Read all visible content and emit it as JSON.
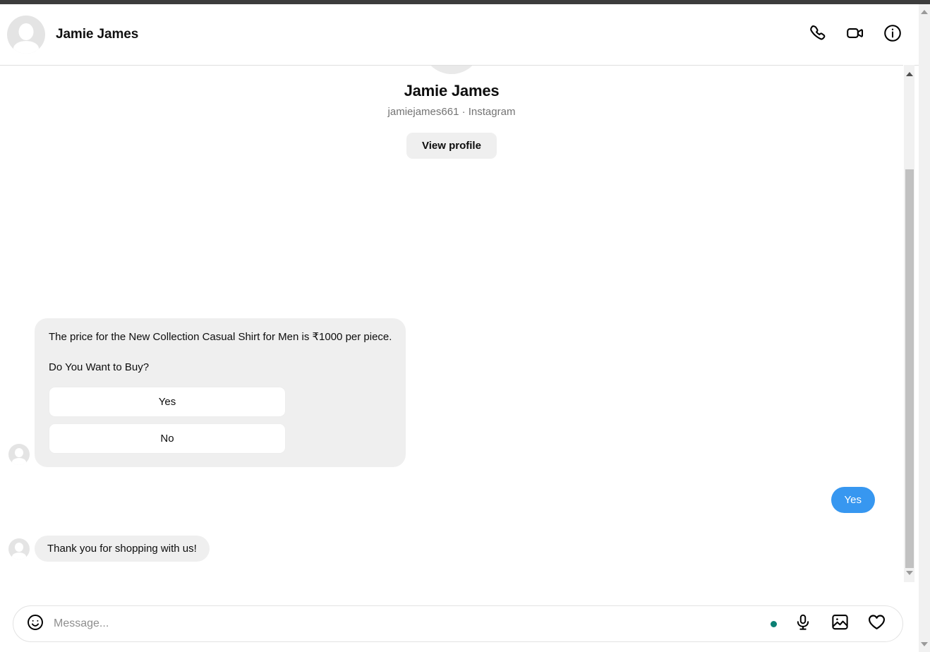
{
  "header": {
    "contact_name": "Jamie James",
    "avatar_icon": "person-avatar-icon",
    "actions": [
      {
        "name": "audio-call",
        "icon": "phone-icon"
      },
      {
        "name": "video-call",
        "icon": "video-camera-icon"
      },
      {
        "name": "conversation-info",
        "icon": "info-circle-icon"
      }
    ]
  },
  "profile_intro": {
    "name": "Jamie James",
    "handle_line": "jamiejames661 · Instagram",
    "view_profile_label": "View profile"
  },
  "conversation": {
    "product_message": {
      "price_line": "The price for the New Collection Casual Shirt for Men is ₹1000 per piece.",
      "question_line": "Do You Want to Buy?",
      "choices": [
        {
          "label": "Yes"
        },
        {
          "label": "No"
        }
      ]
    },
    "reply_yes": "Yes",
    "thanks_message": "Thank you for shopping with us!"
  },
  "composer": {
    "emoji_icon": "smiley-face-icon",
    "placeholder": "Message...",
    "input_value": "",
    "status_dot_color": "#0b8074",
    "actions": [
      {
        "name": "voice-message",
        "icon": "microphone-icon"
      },
      {
        "name": "attach-image",
        "icon": "image-icon"
      },
      {
        "name": "send-like",
        "icon": "heart-icon"
      }
    ]
  },
  "colors": {
    "outgoing_bubble": "#3797f0",
    "incoming_bubble": "#efefef",
    "accent_button": "#efefef",
    "status_dot": "#0b8074",
    "chrome_strip": "#3c3c3c"
  }
}
